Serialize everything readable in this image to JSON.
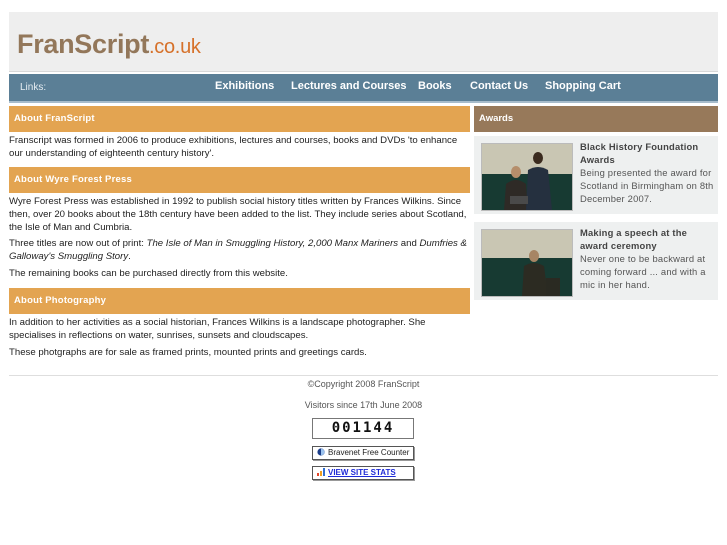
{
  "header": {
    "logo_main": "FranScript",
    "logo_tld": ".co.uk",
    "colors": {
      "header_bg": "#eeeeee",
      "logo": "#93775a",
      "tld": "#d6712a"
    }
  },
  "nav": {
    "label": "Links:",
    "items": [
      {
        "label": "Exhibitions"
      },
      {
        "label": "Lectures and Courses"
      },
      {
        "label": "Books"
      },
      {
        "label": "Contact Us"
      },
      {
        "label": "Shopping Cart"
      }
    ],
    "color": "#5b7f96"
  },
  "main": {
    "sections": [
      {
        "title": "About FranScript",
        "paragraphs": [
          "Franscript was formed in 2006 to produce exhibitions, lectures and courses, books and DVDs 'to enhance our understanding of eighteenth century history'."
        ]
      },
      {
        "title": "About Wyre Forest Press",
        "p1": "Wyre Forest Press was established in 1992 to publish social history titles written by Frances Wilkins. Since then, over 20 books about the 18th century have been added to the list. They include series about Scotland, the Isle of Man and Cumbria.",
        "p2_prefix": "Three titles are now out of print: ",
        "p2_title1": "The Isle of Man in Smuggling History",
        "p2_sep": ", ",
        "p2_title2": "2,000 Manx Mariners",
        "p2_and": " and ",
        "p2_title3": "Dumfries & Galloway's Smuggling Story",
        "p2_end": ".",
        "p3": "The remaining books can be purchased directly from this website."
      },
      {
        "title": "About Photography",
        "paragraphs": [
          "In addition to her activities as a social historian, Frances Wilkins is a landscape photographer. She specialises in reflections on water, sunrises, sunsets and cloudscapes.",
          "These photgraphs are for sale as framed prints, mounted prints and greetings cards."
        ]
      }
    ],
    "section_color": "#e3a451"
  },
  "sidebar": {
    "title": "Awards",
    "color": "#97795a",
    "awards": [
      {
        "heading": "Black History Foundation Awards",
        "text": "Being presented the award for Scotland in Birmingham on 8th December 2007."
      },
      {
        "heading": "Making a speech at the award ceremony",
        "text": "Never one to be backward at coming forward ... and with a mic in her hand."
      }
    ]
  },
  "footer": {
    "copyright": "©Copyright 2008 FranScript",
    "visitors_label": "Visitors since 17th June 2008",
    "counter_value": "001144",
    "counter_badge": "Bravenet Free Counter",
    "stats_link": "VIEW SITE STATS"
  }
}
